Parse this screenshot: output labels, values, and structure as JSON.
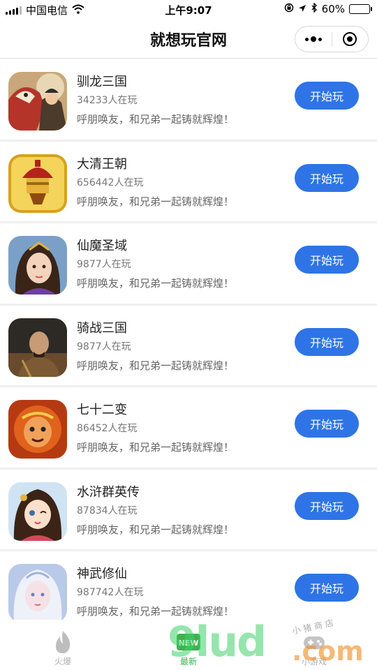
{
  "status_bar": {
    "carrier": "中国电信",
    "time": "上午9:07",
    "battery": "60%",
    "battery_level": 0.6
  },
  "nav": {
    "title": "就想玩官网"
  },
  "games": [
    {
      "name": "驯龙三国",
      "players": "34233人在玩",
      "desc": "呼朋唤友，和兄弟一起铸就辉煌！",
      "button": "开始玩"
    },
    {
      "name": "大清王朝",
      "players": "656442人在玩",
      "desc": "呼朋唤友，和兄弟一起铸就辉煌！",
      "button": "开始玩"
    },
    {
      "name": "仙魔圣域",
      "players": "9877人在玩",
      "desc": "呼朋唤友，和兄弟一起铸就辉煌！",
      "button": "开始玩"
    },
    {
      "name": "骑战三国",
      "players": "9877人在玩",
      "desc": "呼朋唤友，和兄弟一起铸就辉煌！",
      "button": "开始玩"
    },
    {
      "name": "七十二变",
      "players": "86452人在玩",
      "desc": "呼朋唤友，和兄弟一起铸就辉煌！",
      "button": "开始玩"
    },
    {
      "name": "水浒群英传",
      "players": "87834人在玩",
      "desc": "呼朋唤友，和兄弟一起铸就辉煌！",
      "button": "开始玩"
    },
    {
      "name": "神武修仙",
      "players": "987742人在玩",
      "desc": "呼朋唤友，和兄弟一起铸就辉煌！",
      "button": "开始玩"
    }
  ],
  "tabbar": {
    "tabs": [
      {
        "label": "火爆",
        "icon": "flame-icon"
      },
      {
        "label": "最新",
        "icon": "new-badge-icon",
        "badge": "NEW"
      },
      {
        "label": "小游戏",
        "icon": "game-icon"
      }
    ],
    "active_color": "#3fb24f",
    "inactive_color": "#b0b0b0"
  },
  "watermark": {
    "main": "9lud",
    "suffix": ".com",
    "small": "小猪商店"
  },
  "colors": {
    "button": "#2e74e6"
  }
}
